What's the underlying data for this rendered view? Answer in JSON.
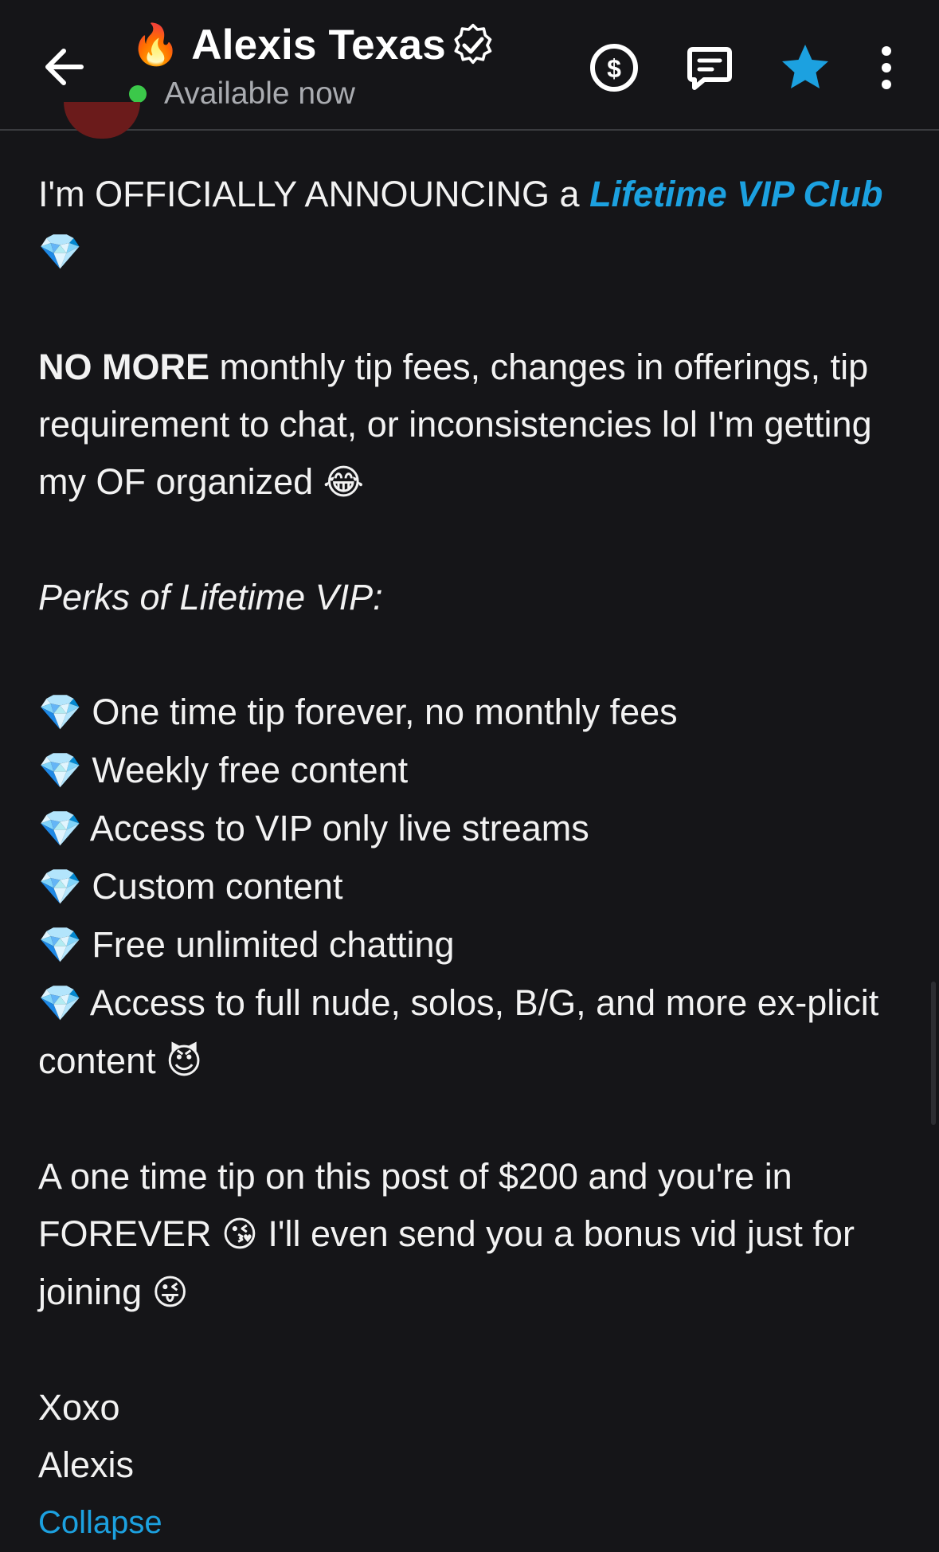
{
  "header": {
    "fire_emoji": "🔥",
    "name": "Alexis Texas",
    "status": "Available now",
    "accent": "#1ca1e0",
    "status_color": "#3bc84a",
    "icons": [
      "back-arrow-icon",
      "dollar-tip-icon",
      "message-icon",
      "star-icon",
      "more-vertical-icon"
    ]
  },
  "post": {
    "line1_text": "I'm OFFICIALLY ANNOUNCING a ",
    "line1_link": "Lifetime VIP Club",
    "diamond": "💎",
    "p2_bold": "NO MORE",
    "p2_text": " monthly tip fees, changes in offerings, tip requirement to chat, or inconsistencies lol I'm getting my OF organized ",
    "p2_emoji": "😂",
    "perks_heading": "Perks of Lifetime VIP:",
    "perks": [
      "One time tip forever, no monthly fees",
      "Weekly free content",
      "Access to VIP only live streams",
      "Custom content",
      "Free unlimited chatting",
      "Access to full nude, solos, B/G, and more ex-plicit content"
    ],
    "perk_last_emoji": "😈",
    "p4_a": "A one time tip on this post of $200 and you're in FOREVER ",
    "p4_emoji1": "😘",
    "p4_b": " I'll even send you a bonus vid just for joining ",
    "p4_emoji2": "😜",
    "signoff1": "Xoxo",
    "signoff2": "Alexis",
    "collapse_label": "Collapse"
  }
}
